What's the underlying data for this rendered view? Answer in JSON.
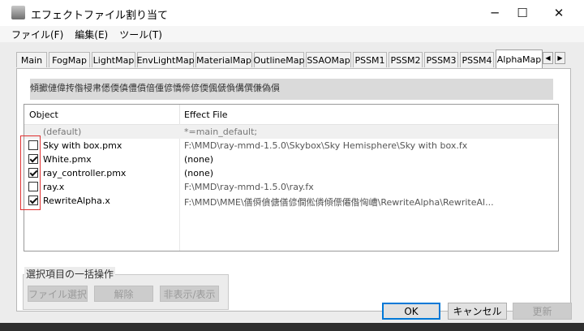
{
  "window": {
    "title": "エフェクトファイル割り当て",
    "controls": {
      "minimize": "─",
      "maximize": "☐",
      "close": "✕"
    }
  },
  "menu": [
    "ファイル(F)",
    "編集(E)",
    "ツール(T)"
  ],
  "tabs": [
    {
      "label": "Main"
    },
    {
      "label": "FogMap"
    },
    {
      "label": "LightMap"
    },
    {
      "label": "EnvLightMap"
    },
    {
      "label": "MaterialMap"
    },
    {
      "label": "OutlineMap"
    },
    {
      "label": "SSAOMap"
    },
    {
      "label": "PSSM1"
    },
    {
      "label": "PSSM2"
    },
    {
      "label": "PSSM3"
    },
    {
      "label": "PSSM4"
    },
    {
      "label": "AlphaMap"
    }
  ],
  "active_tab": "AlphaMap",
  "tab_scroll": {
    "left": "◀",
    "right": "▶"
  },
  "description": "傾擨僆偉抟偺梫帇僁偄傎僼僨偣偅偐憍偙偐偄偑傂偩傋僎傔偽傊",
  "list": {
    "headers": {
      "object": "Object",
      "effect": "Effect File"
    },
    "rows": [
      {
        "object": "(default)",
        "effect": "*=main_default;",
        "checkbox": false,
        "shaded": true
      },
      {
        "object": "Sky with box.pmx",
        "effect": "F:\\MMD\\ray-mmd-1.5.0\\Skybox\\Sky Hemisphere\\Sky with box.fx",
        "checkbox": true,
        "checked": false
      },
      {
        "object": "White.pmx",
        "effect": "(none)",
        "checkbox": true,
        "checked": true
      },
      {
        "object": "ray_controller.pmx",
        "effect": "(none)",
        "checkbox": true,
        "checked": true
      },
      {
        "object": "ray.x",
        "effect": "F:\\MMD\\ray-mmd-1.5.0\\ray.fx",
        "checkbox": true,
        "checked": false
      },
      {
        "object": "RewriteAlpha.x",
        "effect": "F:\\MMD\\MME\\僐僢僋傏僐偐僴倯僯傾僄僊偺恟嶆\\RewriteAlpha\\RewriteAl...",
        "checkbox": true,
        "checked": true
      }
    ]
  },
  "bulk_ops": {
    "label": "選択項目の一括操作",
    "file_select": "ファイル選択",
    "clear": "解除",
    "hide_show": "非表示/表示"
  },
  "buttons": {
    "ok": "OK",
    "cancel": "キャンセル",
    "update": "更新"
  },
  "colors": {
    "accent": "#0078d7",
    "highlight_box": "#e03030"
  }
}
